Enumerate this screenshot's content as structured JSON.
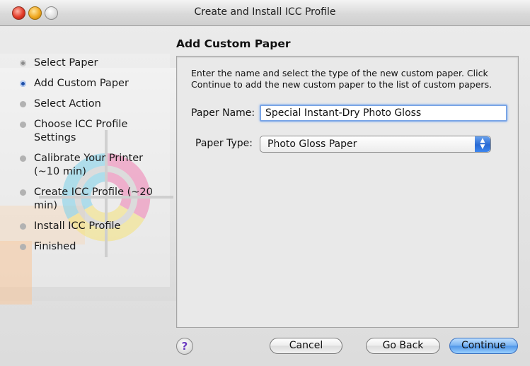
{
  "window": {
    "title": "Create and Install ICC Profile"
  },
  "steps": [
    {
      "label": "Select Paper",
      "state": "done"
    },
    {
      "label": "Add Custom Paper",
      "state": "current"
    },
    {
      "label": "Select Action",
      "state": "pending"
    },
    {
      "label": "Choose ICC Profile Settings",
      "state": "pending"
    },
    {
      "label": "Calibrate Your Printer (~10 min)",
      "state": "pending"
    },
    {
      "label": "Create ICC Profile (~20 min)",
      "state": "pending"
    },
    {
      "label": "Install ICC Profile",
      "state": "pending"
    },
    {
      "label": "Finished",
      "state": "pending"
    }
  ],
  "panel": {
    "title": "Add Custom Paper",
    "instructions": "Enter the name and select the type of the new custom paper. Click Continue to add the new custom paper to the list of custom papers.",
    "paper_name_label": "Paper Name:",
    "paper_name_value": "Special Instant-Dry Photo Gloss",
    "paper_type_label": "Paper Type:",
    "paper_type_value": "Photo Gloss Paper"
  },
  "buttons": {
    "help": "?",
    "cancel": "Cancel",
    "go_back": "Go Back",
    "continue": "Continue"
  },
  "colors": {
    "accent": "#3d86ef",
    "current_step": "#1e4fa8"
  }
}
